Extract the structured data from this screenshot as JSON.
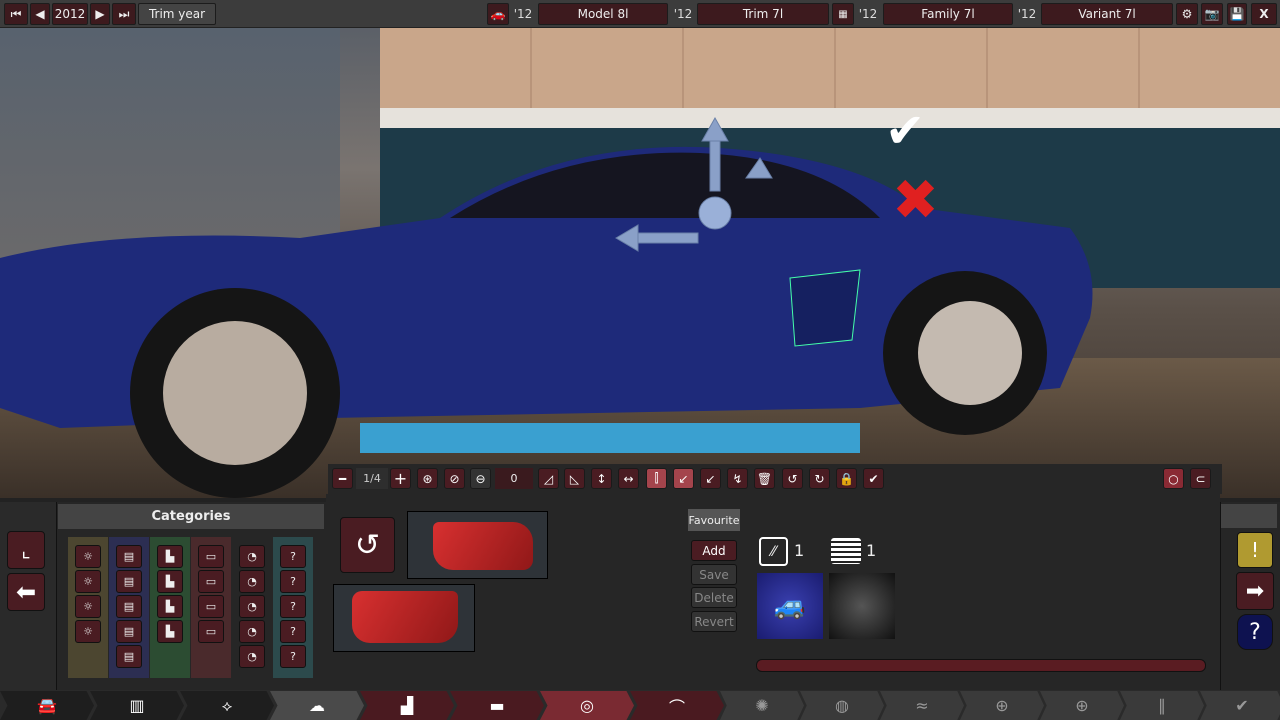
{
  "topbar": {
    "year": "2012",
    "trim_year_label": "Trim year",
    "model": {
      "year": "'12",
      "name": "Model 8l"
    },
    "trim": {
      "year": "'12",
      "name": "Trim 7l"
    },
    "family": {
      "year": "'12",
      "name": "Family 7l"
    },
    "variant": {
      "year": "'12",
      "name": "Variant 7l"
    },
    "icons": [
      "first-icon",
      "prev-icon",
      "next-icon",
      "last-icon",
      "car-icon",
      "engine-icon",
      "gear-icon",
      "camera-icon",
      "save-icon",
      "close-icon"
    ],
    "close_label": "X"
  },
  "toolbar": {
    "page": "1/4",
    "value": "0",
    "icons": [
      "minus",
      "plus",
      "add-fixture",
      "remove-fixture",
      "toggle",
      "skew-left",
      "skew-right",
      "move-vertical",
      "move-horizontal",
      "mirror",
      "flip-1",
      "flip-2",
      "flip-3",
      "delete",
      "rotate-ccw",
      "rotate-cw",
      "lock",
      "confirm"
    ]
  },
  "categories": {
    "title": "Categories",
    "columns_colors": [
      "#4c4630",
      "#2c2e52",
      "#2c4c32",
      "#4a2a2c",
      "#262626",
      "#2c4a4c"
    ]
  },
  "favourites": {
    "title": "Favourite",
    "add": "Add",
    "save": "Save",
    "delete": "Delete",
    "revert": "Revert",
    "count_a": "1",
    "count_b": "1"
  },
  "nav": {
    "items": [
      "car-body",
      "chassis",
      "suspension",
      "body-design",
      "fixtures",
      "trim",
      "lights",
      "interior",
      "wheels",
      "brakes",
      "aero",
      "drivetrain",
      "steering",
      "tuning",
      "finish"
    ],
    "active": "body-design"
  }
}
